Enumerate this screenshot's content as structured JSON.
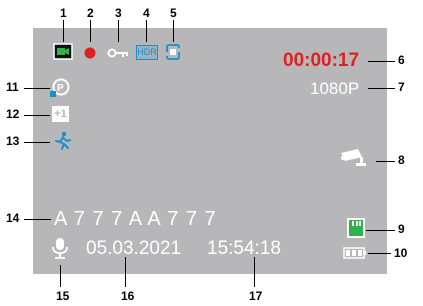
{
  "callouts": {
    "n1": "1",
    "n2": "2",
    "n3": "3",
    "n4": "4",
    "n5": "5",
    "n6": "6",
    "n7": "7",
    "n8": "8",
    "n9": "9",
    "n10": "10",
    "n11": "11",
    "n12": "12",
    "n13": "13",
    "n14": "14",
    "n15": "15",
    "n16": "16",
    "n17": "17"
  },
  "screen": {
    "timer": "00:00:17",
    "resolution": "1080P",
    "plate": "A 7 7 7 A A 7 7 7",
    "date": "05.03.2021",
    "time": "15:54:18",
    "hdr_label": "HDR",
    "ev_label": "+1"
  },
  "icons": [
    "video-mode-icon",
    "record-dot-icon",
    "lock-key-icon",
    "hdr-icon",
    "loop-record-icon",
    "cctv-camera-icon",
    "sd-card-icon",
    "battery-icon",
    "auto-rotate-icon",
    "exposure-icon",
    "motion-detection-icon",
    "microphone-icon"
  ],
  "colors": {
    "screen_bg": "#b7b7b9",
    "timer": "#e02020",
    "accent_blue": "#1a8fd0",
    "accent_green": "#2db34a",
    "record_red": "#e02020"
  }
}
